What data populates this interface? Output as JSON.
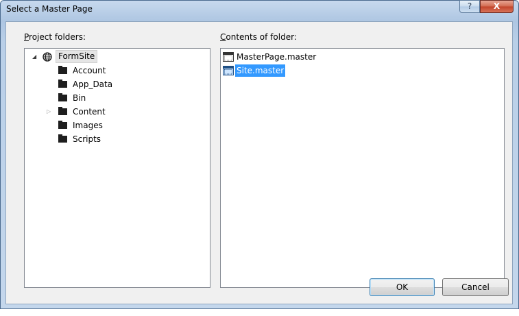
{
  "window": {
    "title": "Select a Master Page",
    "help_glyph": "?",
    "close_glyph": "X"
  },
  "project_panel": {
    "label_access_key": "P",
    "label_rest": "roject folders:",
    "root": {
      "label": "FormSite",
      "icon": "globe-icon",
      "expanded": true
    },
    "folders": [
      {
        "label": "Account",
        "has_children": false
      },
      {
        "label": "App_Data",
        "has_children": false
      },
      {
        "label": "Bin",
        "has_children": false
      },
      {
        "label": "Content",
        "has_children": true
      },
      {
        "label": "Images",
        "has_children": false
      },
      {
        "label": "Scripts",
        "has_children": false
      }
    ]
  },
  "contents_panel": {
    "label_access_key": "C",
    "label_rest": "ontents of folder:",
    "files": [
      {
        "label": "MasterPage.master",
        "selected": false
      },
      {
        "label": "Site.master",
        "selected": true
      }
    ]
  },
  "buttons": {
    "ok": "OK",
    "cancel": "Cancel"
  },
  "colors": {
    "selection": "#3399ff",
    "titlebar": "#b9cfe8",
    "close": "#c2432a"
  }
}
